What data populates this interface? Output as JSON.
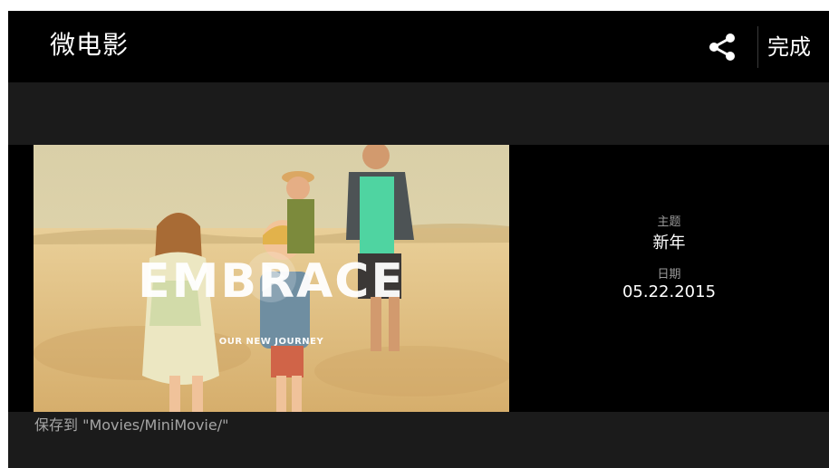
{
  "header": {
    "title": "微电影",
    "share_icon": "share-icon",
    "done_label": "完成"
  },
  "preview": {
    "overlay_title": "EMBRACE",
    "overlay_subtitle": "OUR NEW JOURNEY",
    "play_icon": "play-icon"
  },
  "info": {
    "theme_label": "主题",
    "theme_value": "新年",
    "date_label": "日期",
    "date_value": "05.22.2015"
  },
  "footer": {
    "save_path": "保存到 \"Movies/MiniMovie/\""
  },
  "colors": {
    "background": "#000000",
    "strip": "#1b1b1b",
    "text_primary": "#ffffff",
    "text_secondary": "#9a9a9a"
  }
}
